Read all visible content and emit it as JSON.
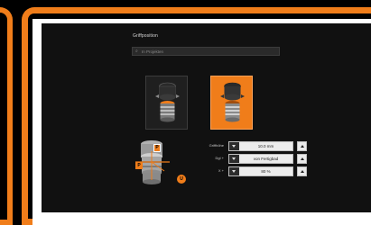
{
  "panel": {
    "title": "Griffposition",
    "search_placeholder": "In Projekten"
  },
  "variants": [
    {
      "name": "standard",
      "selected": false
    },
    {
      "name": "orange-highlight",
      "selected": true
    }
  ],
  "params": [
    {
      "label": "Griffhöhe",
      "value": "10.0 mm"
    },
    {
      "label": "Dgl +",
      "value": "von Fertigbad"
    },
    {
      "label": "X +",
      "value": "80 %"
    }
  ],
  "diagram_markers": [
    "P",
    "P",
    "U"
  ],
  "colors": {
    "accent": "#f07d1a",
    "screen": "#111111",
    "frame_mat": "#ffffff"
  }
}
